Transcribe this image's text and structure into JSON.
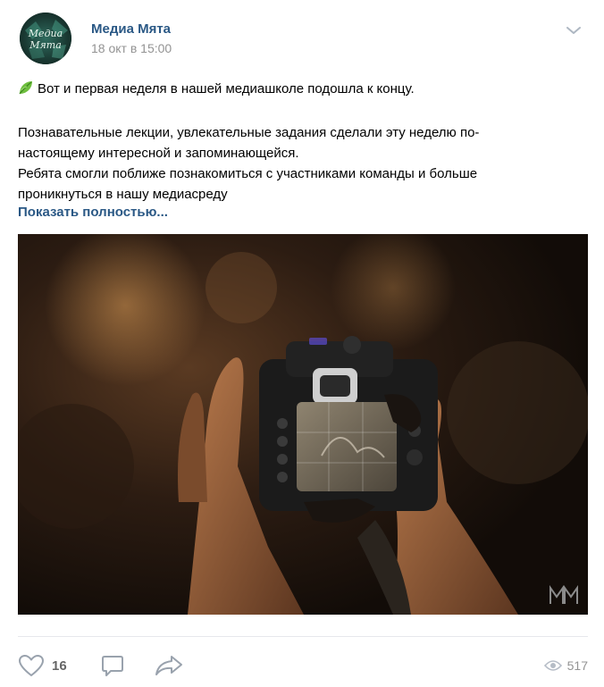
{
  "post": {
    "author": "Медиа Мята",
    "date": "18 окт в 15:00",
    "avatar_text_line1": "Медиа",
    "avatar_text_line2": "Мята",
    "text_line1": "Вот и первая неделя в нашей медиашколе подошла к концу.",
    "text_line2": "Познавательные лекции, увлекательные задания сделали эту неделю по-",
    "text_line3": "настоящему интересной и запоминающейся.",
    "text_line4": "Ребята смогли поближе познакомиться с участниками команды и больше",
    "text_line5": "проникнуться в нашу медиасреду",
    "show_more": "Показать полностью...",
    "photo_watermark": "MM"
  },
  "actions": {
    "likes": "16",
    "views": "517"
  },
  "icons": {
    "leaf": "leaf-emoji-icon",
    "menu": "chevron-down-icon",
    "like": "heart-icon",
    "comment": "comment-icon",
    "share": "share-arrow-icon",
    "views": "eye-icon"
  },
  "colors": {
    "link": "#2a5885",
    "muted": "#939393",
    "action_icon": "#99a2ad"
  }
}
